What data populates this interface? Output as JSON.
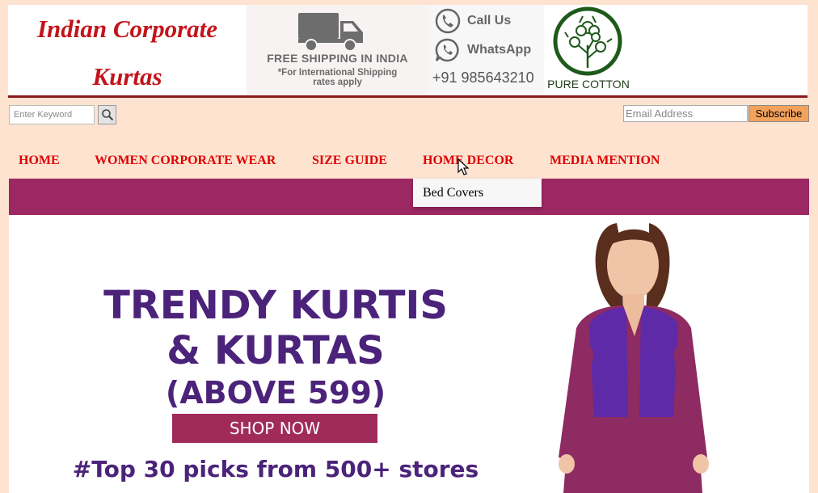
{
  "header": {
    "brand_line1": "Indian  Corporate",
    "brand_line2": "Kurtas",
    "shipping_title": "FREE SHIPPING IN INDIA",
    "shipping_note1": "*For International Shipping",
    "shipping_note2": "rates apply",
    "call_label": "Call Us",
    "whatsapp_label": "WhatsApp",
    "phone": "+91 985643210",
    "cotton_label": "PURE COTTON"
  },
  "toolbar": {
    "search_placeholder": "Enter Keyword",
    "email_placeholder": "Email Address",
    "subscribe_label": "Subscribe"
  },
  "nav": {
    "items": [
      "HOME",
      "WOMEN CORPORATE WEAR",
      "SIZE GUIDE",
      "HOME DECOR",
      "MEDIA MENTION"
    ],
    "dropdown_item": "Bed Covers"
  },
  "banner": {
    "line1": "TRENDY KURTIS",
    "line2": "& KURTAS",
    "line3": "(ABOVE 599)",
    "shop_now": "SHOP NOW",
    "picks": "#Top 30 picks from 500+ stores"
  },
  "colors": {
    "page_bg": "#fde3d0",
    "brand_red": "#c3141b",
    "nav_red": "#e00000",
    "bar_purple": "#9b2862",
    "banner_text": "#4b237a",
    "subscribe_orange": "#f3a25c"
  }
}
